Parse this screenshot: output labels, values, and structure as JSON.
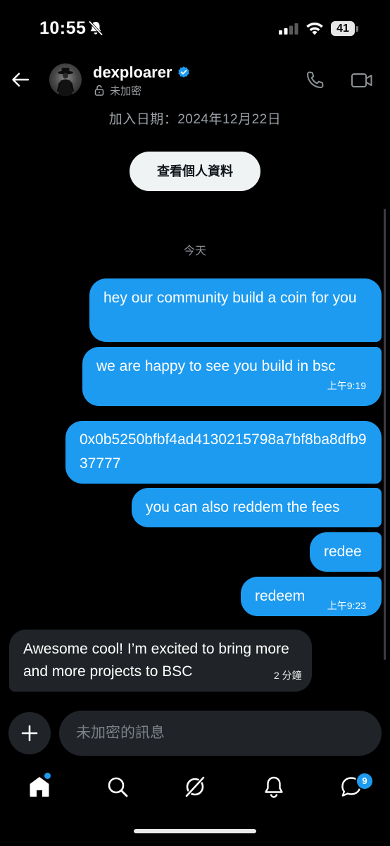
{
  "status_bar": {
    "time": "10:55",
    "battery": "41"
  },
  "header": {
    "contact_name": "dexploarer",
    "encryption_label": "未加密",
    "join_date": "加入日期：2024年12月22日",
    "view_profile_label": "查看個人資料"
  },
  "conversation": {
    "day_divider": "今天",
    "messages": [
      {
        "direction": "outgoing",
        "text": "hey our community build a coin for you",
        "timestamp": ""
      },
      {
        "direction": "outgoing",
        "text": "we are happy to see you build in bsc",
        "timestamp": "上午9:19"
      },
      {
        "direction": "outgoing",
        "text": "0x0b5250bfbf4ad4130215798a7bf8ba8dfb937777",
        "timestamp": ""
      },
      {
        "direction": "outgoing",
        "text": "you can also reddem the fees",
        "timestamp": ""
      },
      {
        "direction": "outgoing",
        "text": "redee",
        "timestamp": ""
      },
      {
        "direction": "outgoing",
        "text": "redeem",
        "timestamp": "上午9:23"
      },
      {
        "direction": "incoming",
        "text": "Awesome cool! I’m excited to bring more and more projects to BSC",
        "timestamp": "2 分鐘"
      }
    ]
  },
  "composer": {
    "placeholder": "未加密的訊息"
  },
  "bottom_nav": {
    "items": [
      "home-icon",
      "search-icon",
      "grok-icon",
      "notifications-bell-icon",
      "messages-icon"
    ],
    "messages_badge": "9"
  },
  "colors": {
    "accent": "#1d9bf0",
    "incoming_bubble": "#202327",
    "background": "#000000"
  }
}
